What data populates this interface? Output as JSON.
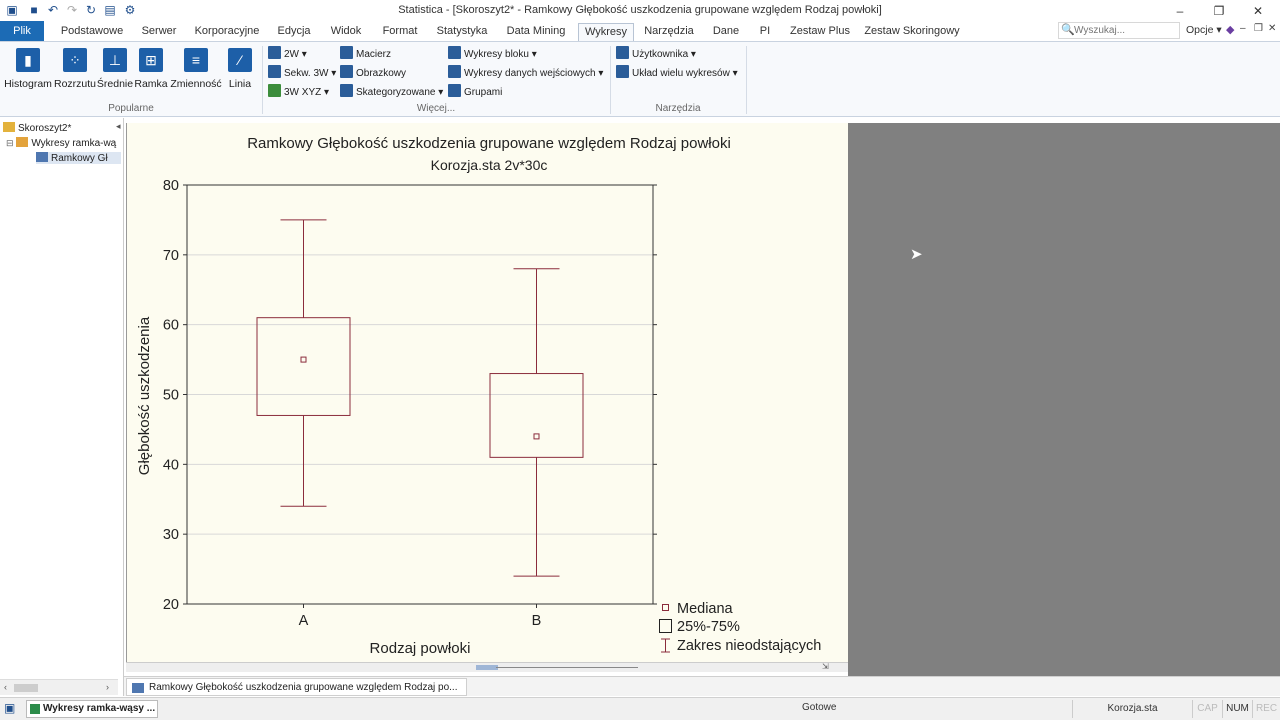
{
  "window": {
    "title": "Statistica - [Skoroszyt2* - Ramkowy   Głębokość uszkodzenia grupowane względem Rodzaj powłoki]"
  },
  "menu": {
    "file": "Plik",
    "tabs": [
      "Podstawowe",
      "Serwer",
      "Korporacyjne",
      "Edycja",
      "Widok",
      "Format",
      "Statystyka",
      "Data Mining",
      "Wykresy",
      "Narzędzia",
      "Dane",
      "PI",
      "Zestaw Plus",
      "Zestaw Skoringowy"
    ],
    "active_tab": "Wykresy",
    "search_placeholder": "Wyszukaj...",
    "options": "Opcje"
  },
  "ribbon": {
    "popular": {
      "label": "Popularne",
      "buttons": [
        "Histogram",
        "Rozrzutu",
        "Średnie",
        "Ramka",
        "Zmienność",
        "Linia"
      ]
    },
    "more": {
      "label": "Więcej...",
      "col1": [
        "2W",
        "Sekw. 3W",
        "3W XYZ"
      ],
      "col2": [
        "Macierz",
        "Obrazkowy",
        "Skategoryzowane"
      ],
      "col3": [
        "Wykresy bloku",
        "Wykresy danych wejściowych",
        "Grupami"
      ]
    },
    "tools": {
      "label": "Narzędzia",
      "items": [
        "Użytkownika",
        "Układ wielu wykresów"
      ]
    }
  },
  "tree": {
    "root": "Skoroszyt2*",
    "folder": "Wykresy ramka-wą",
    "leaf": "Ramkowy  Gł"
  },
  "chart_data": {
    "type": "box",
    "title": "Ramkowy    Głębokość uszkodzenia grupowane względem Rodzaj powłoki",
    "subtitle": "Korozja.sta 2v*30c",
    "xlabel": "Rodzaj powłoki",
    "ylabel": "Głębokość uszkodzenia",
    "ylim": [
      20,
      80
    ],
    "yticks": [
      "20",
      "30",
      "40",
      "50",
      "60",
      "70",
      "80"
    ],
    "categories": [
      "A",
      "B"
    ],
    "boxes": [
      {
        "category": "A",
        "min": 34,
        "q1": 47,
        "median": 55,
        "q3": 61,
        "max": 75
      },
      {
        "category": "B",
        "min": 24,
        "q1": 41,
        "median": 44,
        "q3": 53,
        "max": 68
      }
    ],
    "grid": true,
    "legend_position": "bottom-right",
    "legend": [
      "Mediana",
      "25%-75%",
      "Zakres nieodstających"
    ],
    "color": "#8b2c3c"
  },
  "doc_tab": "Ramkowy   Głębokość uszkodzenia grupowane względem Rodzaj po...",
  "status": {
    "taskbar_item": "Wykresy ramka-wąsy ...",
    "ready": "Gotowe",
    "file": "Korozja.sta",
    "cap": "CAP",
    "num": "NUM",
    "rec": "REC"
  }
}
